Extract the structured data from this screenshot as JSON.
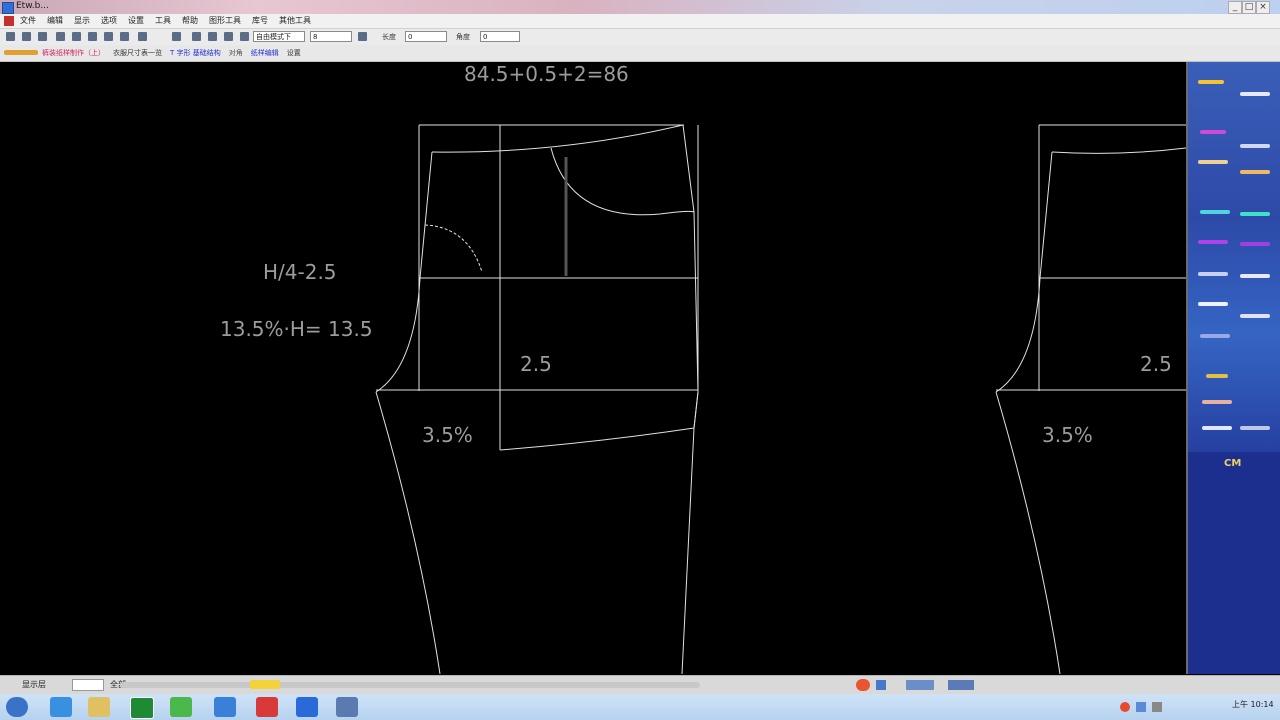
{
  "window": {
    "title": "Etw.b...",
    "controls": [
      "_",
      "□",
      "×"
    ]
  },
  "menubar": {
    "items": [
      "文件",
      "编辑",
      "显示",
      "选项",
      "设置",
      "工具",
      "帮助",
      "图形工具",
      "库号",
      "其他工具"
    ]
  },
  "toolbar": {
    "mode_select": "自由模式下",
    "zoom_value": "8",
    "width_label": "长度",
    "width_value": "0",
    "angle_label": "角度",
    "angle_value": "0"
  },
  "tabs": [
    "裤装纸样制作（上）",
    "衣服尺寸表一览",
    "T 字形 基础结构",
    "对角",
    "纸样编辑",
    "设置"
  ],
  "canvas": {
    "formula_top": "84.5+0.5+2=86",
    "label_h4": "H/4-2.5",
    "label_percent_h": "13.5%·H= 13.5",
    "label_25_left": "2.5",
    "label_35_left": "3.5%",
    "label_25_right": "2.5",
    "label_35_right": "3.5%",
    "line_color": "#e2e2e2",
    "text_color": "#9c9c9c"
  },
  "right_panel": {
    "unit": "CM",
    "bg_color": "#1c2f8e"
  },
  "statusbar": {
    "left_label": "显示层",
    "mid_label": "全部"
  },
  "taskbar": {
    "clock": "上午 10:14"
  },
  "icons": [
    "app-icon",
    "new-file-icon",
    "open-icon",
    "save-icon",
    "zoom-in-icon",
    "zoom-out-icon",
    "pan-icon",
    "select-icon",
    "move-icon",
    "start-icon",
    "ime-icon"
  ]
}
